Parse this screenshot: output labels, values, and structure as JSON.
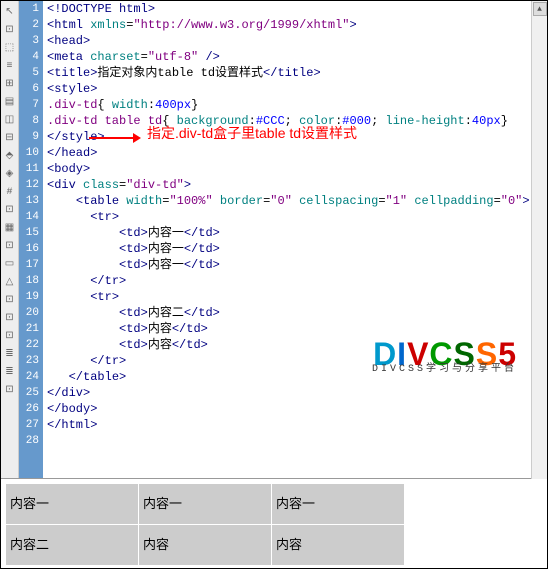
{
  "lines": [
    {
      "n": "1",
      "html": "<span class='tag'>&lt;!DOCTYPE html&gt;</span>"
    },
    {
      "n": "2",
      "html": "<span class='tag'>&lt;html</span> <span class='attr'>xmlns</span>=<span class='val'>\"http://www.w3.org/1999/xhtml\"</span><span class='tag'>&gt;</span>"
    },
    {
      "n": "3",
      "html": "<span class='tag'>&lt;head&gt;</span>"
    },
    {
      "n": "4",
      "html": "<span class='tag'>&lt;meta</span> <span class='attr'>charset</span>=<span class='val'>\"utf-8\"</span> <span class='tag'>/&gt;</span>"
    },
    {
      "n": "5",
      "html": "<span class='tag'>&lt;title&gt;</span><span class='txt'>指定对象内table td设置样式</span><span class='tag'>&lt;/title&gt;</span>"
    },
    {
      "n": "6",
      "html": "<span class='tag'>&lt;style&gt;</span>"
    },
    {
      "n": "7",
      "html": "<span class='sel'>.div-td</span>{ <span class='prop'>width</span>:<span class='propval'>400px</span>}"
    },
    {
      "n": "8",
      "html": "<span class='sel'>.div-td table td</span>{ <span class='prop'>background</span>:<span class='propval'>#CCC</span>; <span class='prop'>color</span>:<span class='propval'>#000</span>; <span class='prop'>line-height</span>:<span class='propval'>40px</span>}"
    },
    {
      "n": "9",
      "html": "<span class='tag'>&lt;/style&gt;</span>"
    },
    {
      "n": "10",
      "html": "<span class='tag'>&lt;/head&gt;</span>"
    },
    {
      "n": "11",
      "html": "<span class='tag'>&lt;body&gt;</span>"
    },
    {
      "n": "12",
      "html": "<span class='tag'>&lt;div</span> <span class='attr'>class</span>=<span class='val'>\"div-td\"</span><span class='tag'>&gt;</span>"
    },
    {
      "n": "13",
      "html": "    <span class='tag'>&lt;table</span> <span class='attr'>width</span>=<span class='val'>\"100%\"</span> <span class='attr'>border</span>=<span class='val'>\"0\"</span> <span class='attr'>cellspacing</span>=<span class='val'>\"1\"</span> <span class='attr'>cellpadding</span>=<span class='val'>\"0\"</span><span class='tag'>&gt;</span>"
    },
    {
      "n": "14",
      "html": "      <span class='tag'>&lt;tr&gt;</span>"
    },
    {
      "n": "15",
      "html": "          <span class='tag'>&lt;td&gt;</span><span class='txt'>内容一</span><span class='tag'>&lt;/td&gt;</span>"
    },
    {
      "n": "16",
      "html": "          <span class='tag'>&lt;td&gt;</span><span class='txt'>内容一</span><span class='tag'>&lt;/td&gt;</span>"
    },
    {
      "n": "17",
      "html": "          <span class='tag'>&lt;td&gt;</span><span class='txt'>内容一</span><span class='tag'>&lt;/td&gt;</span>"
    },
    {
      "n": "18",
      "html": "      <span class='tag'>&lt;/tr&gt;</span>"
    },
    {
      "n": "19",
      "html": "      <span class='tag'>&lt;tr&gt;</span>"
    },
    {
      "n": "20",
      "html": "          <span class='tag'>&lt;td&gt;</span><span class='txt'>内容二</span><span class='tag'>&lt;/td&gt;</span>"
    },
    {
      "n": "21",
      "html": "          <span class='tag'>&lt;td&gt;</span><span class='txt'>内容</span><span class='tag'>&lt;/td&gt;</span>"
    },
    {
      "n": "22",
      "html": "          <span class='tag'>&lt;td&gt;</span><span class='txt'>内容</span><span class='tag'>&lt;/td&gt;</span>"
    },
    {
      "n": "23",
      "html": "      <span class='tag'>&lt;/tr&gt;</span>"
    },
    {
      "n": "24",
      "html": "   <span class='tag'>&lt;/table&gt;</span>"
    },
    {
      "n": "25",
      "html": "<span class='tag'>&lt;/div&gt;</span>"
    },
    {
      "n": "26",
      "html": "<span class='tag'>&lt;/body&gt;</span>"
    },
    {
      "n": "27",
      "html": "<span class='tag'>&lt;/html&gt;</span>"
    },
    {
      "n": "28",
      "html": ""
    }
  ],
  "annotation": "指定.div-td盒子里table td设置样式",
  "watermark": {
    "brand": "DIVCSS5",
    "sub": "DIVCSS学习与分享平台"
  },
  "preview_rows": [
    [
      "内容一",
      "内容一",
      "内容一"
    ],
    [
      "内容二",
      "内容",
      "内容"
    ]
  ],
  "tools": [
    "↖",
    "⊡",
    "⬚",
    "≡",
    "⊞",
    "▤",
    "◫",
    "⊟",
    "⬘",
    "◈",
    "#",
    "⊡",
    "▦",
    "⊡",
    "▭",
    "△",
    "⊡",
    "⊡",
    "⊡",
    "≣",
    "≣",
    "⊡"
  ]
}
